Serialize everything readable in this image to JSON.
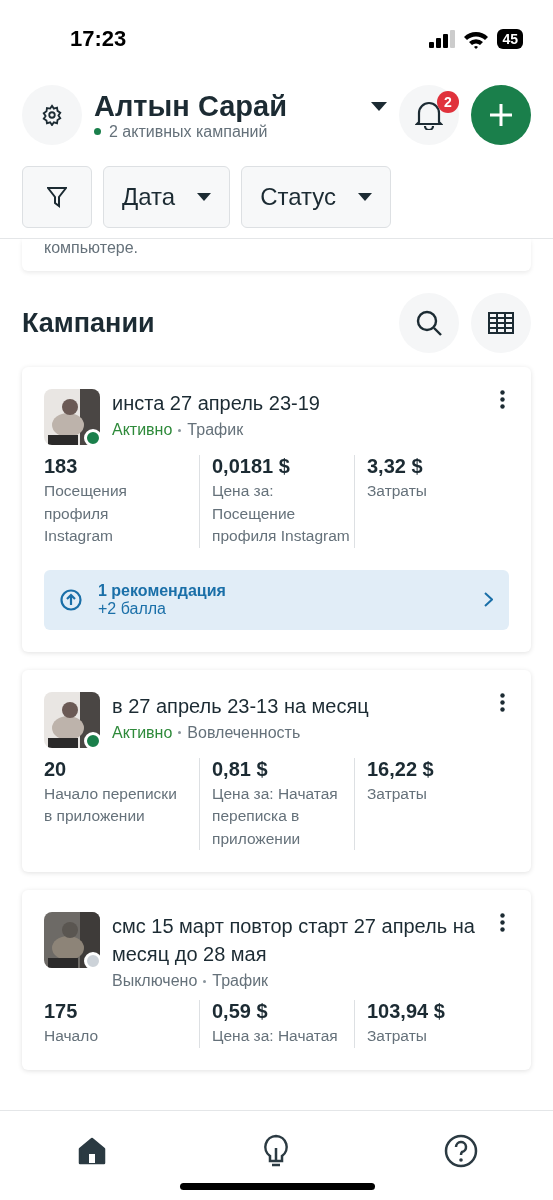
{
  "status_bar": {
    "time": "17:23",
    "battery": "45"
  },
  "header": {
    "title": "Алтын Сарай",
    "subtitle": "2 активных кампаний",
    "notifications": "2"
  },
  "filters": [
    {
      "kind": "icon"
    },
    {
      "kind": "dropdown",
      "label": "Дата"
    },
    {
      "kind": "dropdown",
      "label": "Статус"
    }
  ],
  "notice": {
    "text": "компьютере."
  },
  "section": {
    "title": "Кампании"
  },
  "campaigns": [
    {
      "name": "инста 27 апрель 23-19",
      "active": true,
      "status": "Активно",
      "objective": "Трафик",
      "metrics": [
        {
          "value": "183",
          "label": "Посещения профиля Instagram"
        },
        {
          "value": "0,0181 $",
          "label": "Цена за: Посещение профиля Instagram"
        },
        {
          "value": "3,32 $",
          "label": "Затраты"
        }
      ],
      "recommendation": {
        "title": "1 рекомендация",
        "subtitle": "+2 балла"
      }
    },
    {
      "name": "в 27 апрель 23-13 на месяц",
      "active": true,
      "status": "Активно",
      "objective": "Вовлеченность",
      "metrics": [
        {
          "value": "20",
          "label": "Начало переписки в приложении"
        },
        {
          "value": "0,81 $",
          "label": "Цена за: Начатая переписка в приложении"
        },
        {
          "value": "16,22 $",
          "label": "Затраты"
        }
      ]
    },
    {
      "name": "смс 15 март повтор старт 27 апрель на месяц до 28 мая",
      "active": false,
      "status": "Выключено",
      "objective": "Трафик",
      "metrics": [
        {
          "value": "175",
          "label": "Начало"
        },
        {
          "value": "0,59 $",
          "label": "Цена за: Начатая"
        },
        {
          "value": "103,94 $",
          "label": "Затраты"
        }
      ]
    }
  ],
  "nav": [
    {
      "kind": "home",
      "selected": true
    },
    {
      "kind": "bulb",
      "selected": false
    },
    {
      "kind": "help",
      "selected": false
    }
  ]
}
